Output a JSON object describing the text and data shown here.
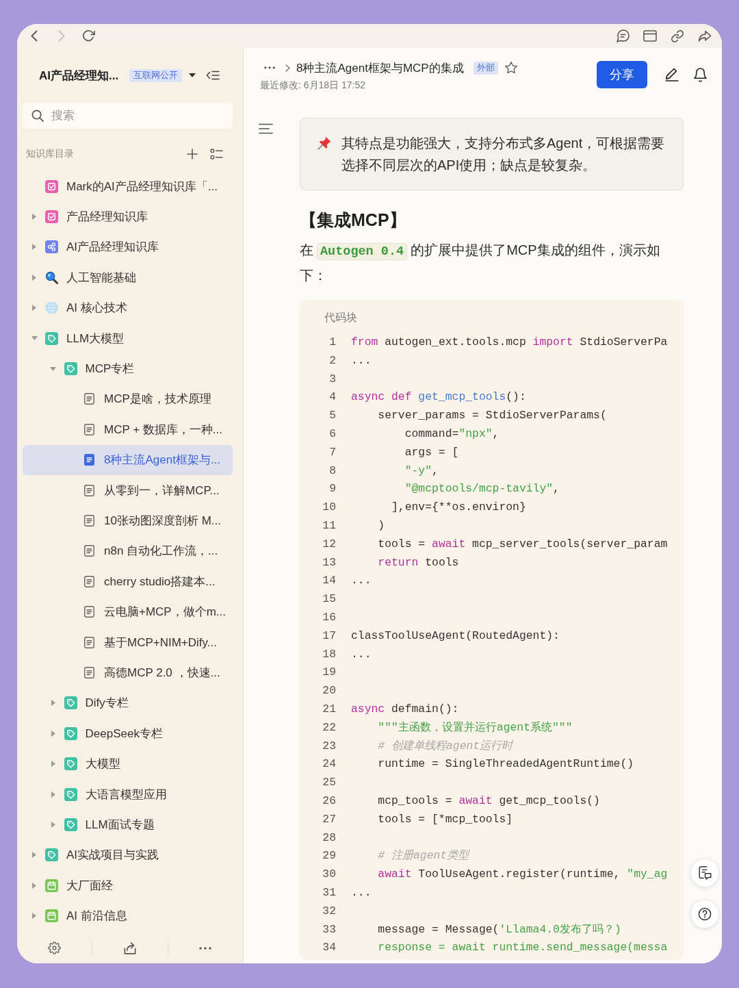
{
  "browser_bar": {
    "back": {
      "disabled": false
    },
    "forward": {
      "disabled": true
    }
  },
  "sidebar": {
    "title": "AI产品经理知...",
    "visibility_badge": "互联网公开",
    "search": {
      "placeholder": "搜索"
    },
    "section_label": "知识库目录",
    "tree": [
      {
        "label": "Mark的AI产品经理知识库「...",
        "kind": "checklist",
        "selected": false
      },
      {
        "label": "产品经理知识库",
        "kind": "checklist",
        "expanded": false,
        "selected": false
      },
      {
        "label": "AI产品经理知识库",
        "kind": "nodes",
        "expanded": false,
        "selected": false
      },
      {
        "label": "人工智能基础",
        "kind": "magnifier",
        "expanded": false,
        "selected": false
      },
      {
        "label": "AI 核心技术",
        "kind": "globe",
        "expanded": false,
        "selected": false
      },
      {
        "label": "LLM大模型",
        "kind": "tag",
        "expanded": true,
        "selected": false,
        "children": [
          {
            "label": "MCP专栏",
            "kind": "tag",
            "expanded": true,
            "selected": false,
            "children": [
              {
                "label": "MCP是啥，技术原理",
                "kind": "page",
                "selected": false
              },
              {
                "label": "MCP + 数据库，一种...",
                "kind": "page",
                "selected": false
              },
              {
                "label": "8种主流Agent框架与...",
                "kind": "page",
                "selected": true
              },
              {
                "label": "从零到一，详解MCP...",
                "kind": "page",
                "selected": false
              },
              {
                "label": "10张动图深度剖析 M...",
                "kind": "page",
                "selected": false
              },
              {
                "label": "n8n 自动化工作流，...",
                "kind": "page",
                "selected": false
              },
              {
                "label": "cherry studio搭建本...",
                "kind": "page",
                "selected": false
              },
              {
                "label": "云电脑+MCP，做个m...",
                "kind": "page",
                "selected": false
              },
              {
                "label": "基于MCP+NIM+Dify...",
                "kind": "page",
                "selected": false
              },
              {
                "label": "高德MCP 2.0 ，快速...",
                "kind": "page",
                "selected": false
              }
            ]
          },
          {
            "label": "Dify专栏",
            "kind": "tag",
            "expanded": false,
            "selected": false
          },
          {
            "label": "DeepSeek专栏",
            "kind": "tag",
            "expanded": false,
            "selected": false
          },
          {
            "label": "大模型",
            "kind": "tag",
            "expanded": false,
            "selected": false
          },
          {
            "label": "大语言模型应用",
            "kind": "tag",
            "expanded": false,
            "selected": false
          },
          {
            "label": "LLM面试专题",
            "kind": "tag",
            "expanded": false,
            "selected": false
          }
        ]
      },
      {
        "label": "AI实战项目与实践",
        "kind": "tag",
        "expanded": false,
        "selected": false
      },
      {
        "label": "大厂面经",
        "kind": "calendar",
        "expanded": false,
        "selected": false
      },
      {
        "label": "AI 前沿信息",
        "kind": "calendar",
        "expanded": false,
        "selected": false
      }
    ]
  },
  "document": {
    "title": "8种主流Agent框架与MCP的集成",
    "badge": "外部",
    "starred": false,
    "last_modified": "最近修改: 6月18日 17:52",
    "share_button": "分享",
    "callout": {
      "text": "其特点是功能强大，支持分布式多Agent，可根据需要选择不同层次的API使用；缺点是较复杂。"
    },
    "heading": "【集成MCP】",
    "paragraph": [
      {
        "kind": "text",
        "text": "在"
      },
      {
        "kind": "code",
        "text": "Autogen 0.4"
      },
      {
        "kind": "text",
        "text": "的扩展中提供了MCP集成的组件，演示如下："
      }
    ],
    "code_block": {
      "label": "代码块",
      "lines": [
        {
          "number": "1",
          "tokens": [
            {
              "kind": "keyword",
              "text": "from"
            },
            {
              "kind": "plain",
              "text": " autogen_ext.tools.mcp "
            },
            {
              "kind": "keyword",
              "text": "import"
            },
            {
              "kind": "plain",
              "text": " StdioServerPa"
            }
          ]
        },
        {
          "number": "2",
          "tokens": [
            {
              "kind": "plain",
              "text": "..."
            }
          ]
        },
        {
          "number": "3"
        },
        {
          "number": "4",
          "tokens": [
            {
              "kind": "keyword",
              "text": "async def"
            },
            {
              "kind": "function",
              "text": " get_mcp_tools"
            },
            {
              "kind": "plain",
              "text": "():"
            }
          ]
        },
        {
          "number": "5",
          "tokens": [
            {
              "kind": "plain",
              "text": "    server_params = StdioServerParams("
            }
          ]
        },
        {
          "number": "6",
          "tokens": [
            {
              "kind": "plain",
              "text": "        command="
            },
            {
              "kind": "string",
              "text": "\"npx\""
            },
            {
              "kind": "plain",
              "text": ","
            }
          ]
        },
        {
          "number": "7",
          "tokens": [
            {
              "kind": "plain",
              "text": "        args = ["
            }
          ]
        },
        {
          "number": "8",
          "tokens": [
            {
              "kind": "string",
              "text": "        \"-y\""
            },
            {
              "kind": "plain",
              "text": ","
            }
          ]
        },
        {
          "number": "9",
          "tokens": [
            {
              "kind": "string",
              "text": "        \"@mcptools/mcp-tavily\""
            },
            {
              "kind": "plain",
              "text": ","
            }
          ]
        },
        {
          "number": "10",
          "tokens": [
            {
              "kind": "plain",
              "text": "      ],env={**os.environ}"
            }
          ]
        },
        {
          "number": "11",
          "tokens": [
            {
              "kind": "plain",
              "text": "    )"
            }
          ]
        },
        {
          "number": "12",
          "tokens": [
            {
              "kind": "plain",
              "text": "    tools = "
            },
            {
              "kind": "keyword",
              "text": "await"
            },
            {
              "kind": "plain",
              "text": " mcp_server_tools(server_param"
            }
          ]
        },
        {
          "number": "13",
          "tokens": [
            {
              "kind": "keyword",
              "text": "    return"
            },
            {
              "kind": "plain",
              "text": " tools"
            }
          ]
        },
        {
          "number": "14",
          "tokens": [
            {
              "kind": "plain",
              "text": "..."
            }
          ]
        },
        {
          "number": "15"
        },
        {
          "number": "16"
        },
        {
          "number": "17",
          "tokens": [
            {
              "kind": "plain",
              "text": "classToolUseAgent(RoutedAgent):"
            }
          ]
        },
        {
          "number": "18",
          "tokens": [
            {
              "kind": "plain",
              "text": "..."
            }
          ]
        },
        {
          "number": "19"
        },
        {
          "number": "20"
        },
        {
          "number": "21",
          "tokens": [
            {
              "kind": "keyword",
              "text": "async"
            },
            {
              "kind": "plain",
              "text": " defmain():"
            }
          ]
        },
        {
          "number": "22",
          "tokens": [
            {
              "kind": "string",
              "text": "    \"\"\"主函数，设置并运行agent系统\"\"\""
            }
          ]
        },
        {
          "number": "23",
          "tokens": [
            {
              "kind": "comment",
              "text": "    # 创建单线程agent运行时"
            }
          ]
        },
        {
          "number": "24",
          "tokens": [
            {
              "kind": "plain",
              "text": "    runtime = SingleThreadedAgentRuntime()"
            }
          ]
        },
        {
          "number": "25"
        },
        {
          "number": "26",
          "tokens": [
            {
              "kind": "plain",
              "text": "    mcp_tools = "
            },
            {
              "kind": "keyword",
              "text": "await"
            },
            {
              "kind": "plain",
              "text": " get_mcp_tools()"
            }
          ]
        },
        {
          "number": "27",
          "tokens": [
            {
              "kind": "plain",
              "text": "    tools = [*mcp_tools]"
            }
          ]
        },
        {
          "number": "28"
        },
        {
          "number": "29",
          "tokens": [
            {
              "kind": "comment",
              "text": "    # 注册agent类型"
            }
          ]
        },
        {
          "number": "30",
          "tokens": [
            {
              "kind": "keyword",
              "text": "    await"
            },
            {
              "kind": "plain",
              "text": " ToolUseAgent.register(runtime, "
            },
            {
              "kind": "string",
              "text": "\"my_ag"
            }
          ]
        },
        {
          "number": "31",
          "tokens": [
            {
              "kind": "plain",
              "text": "..."
            }
          ]
        },
        {
          "number": "32"
        },
        {
          "number": "33",
          "tokens": [
            {
              "kind": "plain",
              "text": "    message = Message("
            },
            {
              "kind": "string",
              "text": "'Llama4.0发布了吗？)"
            }
          ]
        },
        {
          "number": "34",
          "tokens": [
            {
              "kind": "string",
              "text": "    response = await runtime.send_message(messa"
            }
          ]
        }
      ]
    }
  }
}
